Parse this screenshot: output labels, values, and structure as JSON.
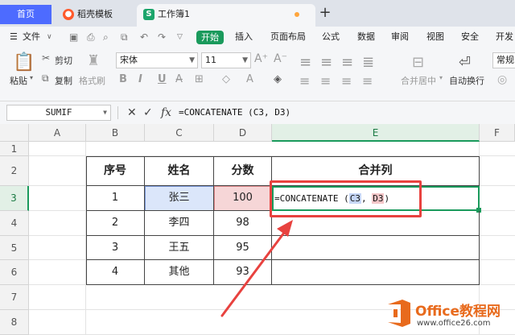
{
  "tabs": {
    "home": "首页",
    "template": "稻壳模板",
    "workbook": "工作簿1",
    "new_tab": "+"
  },
  "menu": {
    "file": "文件",
    "start": "开始",
    "items": [
      "插入",
      "页面布局",
      "公式",
      "数据",
      "审阅",
      "视图",
      "安全",
      "开发"
    ]
  },
  "ribbon": {
    "paste": "粘贴",
    "cut": "剪切",
    "copy": "复制",
    "format_painter": "格式刷",
    "font_name": "宋体",
    "font_size": "11",
    "merge_center": "合并居中",
    "auto_wrap": "自动换行",
    "number_format": "常规"
  },
  "formula_bar": {
    "name_box": "SUMIF",
    "cancel": "✕",
    "confirm": "✓",
    "fx": "fx",
    "formula": "=CONCATENATE (C3, D3)"
  },
  "sheet": {
    "columns": [
      "A",
      "B",
      "C",
      "D",
      "E",
      "F"
    ],
    "rows": [
      "1",
      "2",
      "3",
      "4",
      "5",
      "6",
      "7",
      "8"
    ],
    "headers": [
      "序号",
      "姓名",
      "分数",
      "合并列"
    ],
    "records": [
      {
        "no": "1",
        "name": "张三",
        "score": "100"
      },
      {
        "no": "2",
        "name": "李四",
        "score": "98"
      },
      {
        "no": "3",
        "name": "王五",
        "score": "95"
      },
      {
        "no": "4",
        "name": "其他",
        "score": "93"
      }
    ],
    "active_cell": "E3",
    "edit_formula": {
      "prefix": "=CONCATENATE (",
      "ref1": "C3",
      "sep": ", ",
      "ref2": "D3",
      "suffix": ")"
    }
  },
  "watermark": {
    "title": "Office教程网",
    "url": "www.office26.com"
  },
  "colors": {
    "accent_green": "#1a9a5c",
    "home_tab_blue": "#4d6bff",
    "annotation_red": "#e8423f",
    "ref_c3_bg": "#c6d6f6",
    "ref_d3_bg": "#f3c6c8",
    "watermark_orange": "#e86a1c"
  }
}
